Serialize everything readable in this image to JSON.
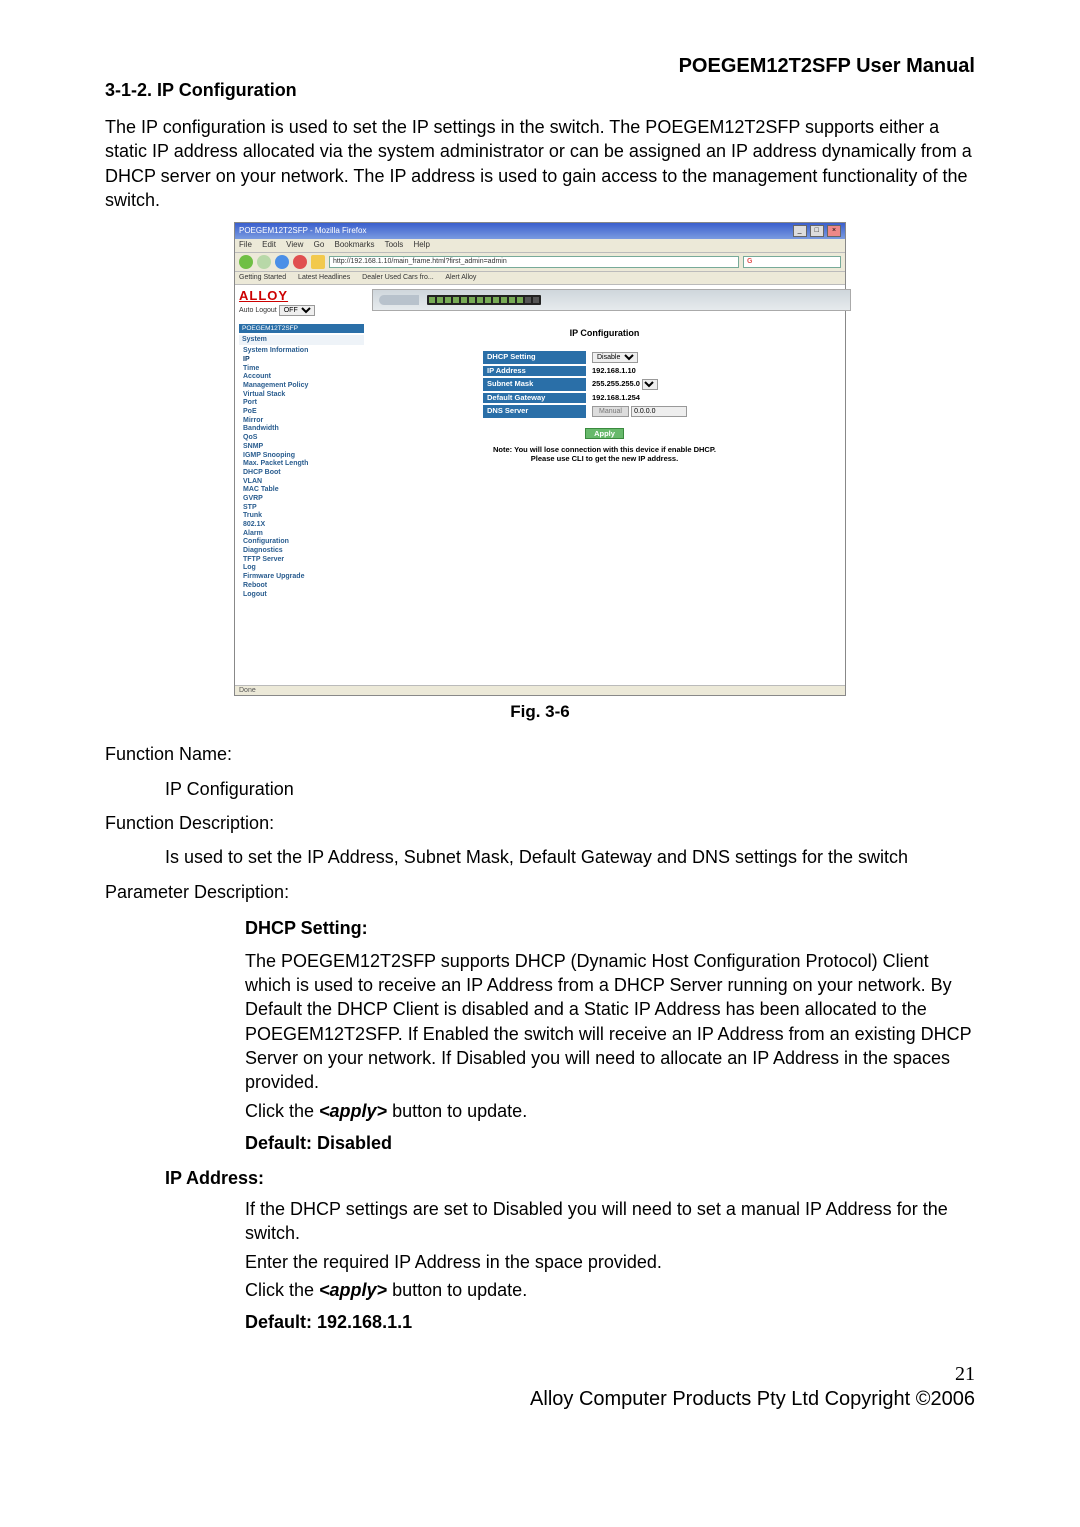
{
  "header": {
    "title": "POEGEM12T2SFP User Manual"
  },
  "section": {
    "title": "3-1-2. IP Configuration"
  },
  "intro": "The IP configuration is used to set the IP settings in the switch. The POEGEM12T2SFP supports either a static IP address allocated via the system administrator or can be assigned an IP address dynamically from a DHCP server on your network. The IP address is used to gain access to the management functionality of the switch.",
  "figure_caption": "Fig. 3-6",
  "fn_name_label": "Function Name:",
  "fn_name_value": "IP Configuration",
  "fn_desc_label": "Function Description:",
  "fn_desc_value": "Is used to set the IP Address, Subnet Mask, Default Gateway and DNS settings for the switch",
  "param_desc_label": "Parameter Description:",
  "dhcp": {
    "title": "DHCP Setting:",
    "body": "The POEGEM12T2SFP supports DHCP (Dynamic Host Configuration Protocol) Client which is used to receive an IP Address from a DHCP Server running on your network. By Default the DHCP Client is disabled and a Static IP Address has been allocated to the POEGEM12T2SFP. If Enabled the switch will receive an IP Address from an existing DHCP Server on your network. If Disabled you will need to allocate an IP Address in the spaces provided.",
    "click_prefix": "Click the ",
    "apply_word": "<apply>",
    "click_suffix": " button to update.",
    "default": "Default: Disabled"
  },
  "ipaddr": {
    "title": "IP Address:",
    "body1": "If the DHCP settings are set to Disabled you will need to set a manual IP Address for the switch.",
    "body2": "Enter the required IP Address in the space provided.",
    "click_prefix": "Click the ",
    "apply_word": "<apply>",
    "click_suffix": " button to update.",
    "default": "Default: 192.168.1.1"
  },
  "page_number": "21",
  "footer": "Alloy Computer Products Pty Ltd Copyright ©2006",
  "screenshot": {
    "browser_title": "POEGEM12T2SFP - Mozilla Firefox",
    "menu": {
      "file": "File",
      "edit": "Edit",
      "view": "View",
      "go": "Go",
      "bookmarks": "Bookmarks",
      "tools": "Tools",
      "help": "Help"
    },
    "url": "http://192.168.1.10/main_frame.html?first_admin=admin",
    "search_placeholder": "G",
    "bookmarks": {
      "a": "Getting Started",
      "b": "Latest Headlines",
      "c": "Dealer Used Cars fro...",
      "d": "Alert Alloy"
    },
    "logo": "ALLOY",
    "auto_logout_label": "Auto Logout",
    "auto_logout_value": "OFF",
    "model": "POEGEM12T2SFP",
    "nav_group": "System",
    "nav": {
      "sysinfo": "System Information",
      "ip": "IP",
      "time": "Time",
      "account": "Account",
      "mgmtpolicy": "Management Policy",
      "vstack": "Virtual Stack",
      "port": "Port",
      "poe": "PoE",
      "mirror": "Mirror",
      "bandwidth": "Bandwidth",
      "qos": "QoS",
      "snmp": "SNMP",
      "igmp": "IGMP Snooping",
      "maxpkt": "Max. Packet Length",
      "dhcpboot": "DHCP Boot",
      "vlan": "VLAN",
      "mactable": "MAC Table",
      "gvrp": "GVRP",
      "stp": "STP",
      "trunk": "Trunk",
      "8021x": "802.1X",
      "alarm": "Alarm",
      "config": "Configuration",
      "diag": "Diagnostics",
      "tftp": "TFTP Server",
      "log": "Log",
      "fwupgrade": "Firmware Upgrade",
      "reboot": "Reboot",
      "logout": "Logout"
    },
    "page_title": "IP Configuration",
    "labels": {
      "dhcp": "DHCP Setting",
      "ip": "IP Address",
      "subnet": "Subnet Mask",
      "gateway": "Default Gateway",
      "dns": "DNS Server"
    },
    "values": {
      "dhcp": "Disable",
      "ip": "192.168.1.10",
      "subnet": "255.255.255.0",
      "gateway": "192.168.1.254",
      "dns_btn": "Manual",
      "dns": "0.0.0.0"
    },
    "apply": "Apply",
    "note1": "Note: You will lose connection with this device if enable DHCP.",
    "note2": "Please use CLI to get the new IP address.",
    "status": "Done"
  }
}
